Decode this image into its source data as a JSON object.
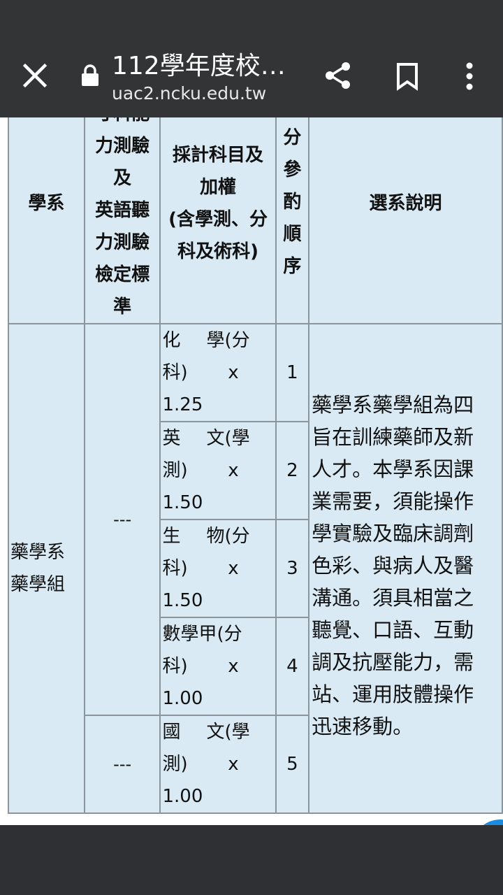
{
  "browser": {
    "title": "112學年度校…",
    "url": "uac2.ncku.edu.tw",
    "icons": [
      "close-icon",
      "lock-icon",
      "share-icon",
      "bookmark-icon",
      "more-vert-icon"
    ]
  },
  "table": {
    "headers": {
      "dept": "學系",
      "ability_lines": [
        "寸科能",
        "力測驗",
        "及",
        "英語聽",
        "力測驗",
        "檢定標",
        "準"
      ],
      "subjects_lines": [
        "採計科目及",
        "加權",
        "(含學測、分",
        "科及術科)"
      ],
      "order_lines": [
        "同",
        "分",
        "參",
        "酌",
        "順",
        "序"
      ],
      "desc": "選系說明"
    },
    "dept_lines": [
      "藥學系",
      "藥學組"
    ],
    "dashes": [
      "---",
      "---"
    ],
    "subjects": [
      {
        "name_a": "化",
        "name_b": "學(分",
        "src_a": "科)",
        "x": "x",
        "weight": "1.25",
        "order": "1"
      },
      {
        "name_a": "英",
        "name_b": "文(學",
        "src_a": "測)",
        "x": "x",
        "weight": "1.50",
        "order": "2"
      },
      {
        "name_a": "生",
        "name_b": "物(分",
        "src_a": "科)",
        "x": "x",
        "weight": "1.50",
        "order": "3"
      },
      {
        "name_a": "數學甲(分",
        "name_b": "",
        "src_a": "科)",
        "x": "x",
        "weight": "1.00",
        "order": "4"
      },
      {
        "name_a": "國",
        "name_b": "文(學",
        "src_a": "測)",
        "x": "x",
        "weight": "1.00",
        "order": "5"
      }
    ],
    "desc_lines": [
      "藥學系藥學組為四",
      "旨在訓練藥師及新",
      "人才。本學系因課",
      "業需要，須能操作",
      "學實驗及臨床調劑",
      "色彩、與病人及醫",
      "溝通。須具相當之",
      "聽覺、口語、互動",
      "調及抗壓能力，需",
      "站、運用肢體操作",
      "迅速移動。"
    ]
  },
  "colors": {
    "toolbar": "#333436",
    "table_bg": "#d9eaf4",
    "border": "#8c959b",
    "fab": "#1b8ce0"
  }
}
